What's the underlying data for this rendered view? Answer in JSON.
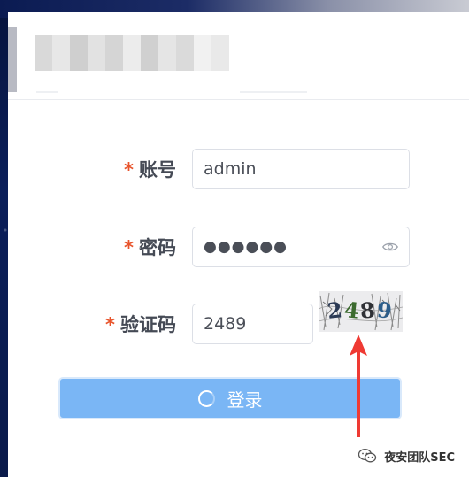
{
  "form": {
    "required_mark": "*",
    "username_label": "账号",
    "username_value": "admin",
    "password_label": "密码",
    "password_masked": "●●●●●●",
    "captcha_label": "验证码",
    "captcha_value": "2489",
    "captcha_image_text": "2489"
  },
  "login_button": {
    "label": "登录",
    "state": "loading"
  },
  "watermark": {
    "text": "夜安团队SEC"
  },
  "colors": {
    "required": "#e8542c",
    "button_bg": "#7ab6f5",
    "annotation_arrow": "#ef3a33"
  },
  "icons": {
    "password_toggle": "eye-icon",
    "button_spinner": "loading-spinner-icon",
    "annotation": "red-arrow",
    "watermark_logo": "wechat-icon"
  }
}
